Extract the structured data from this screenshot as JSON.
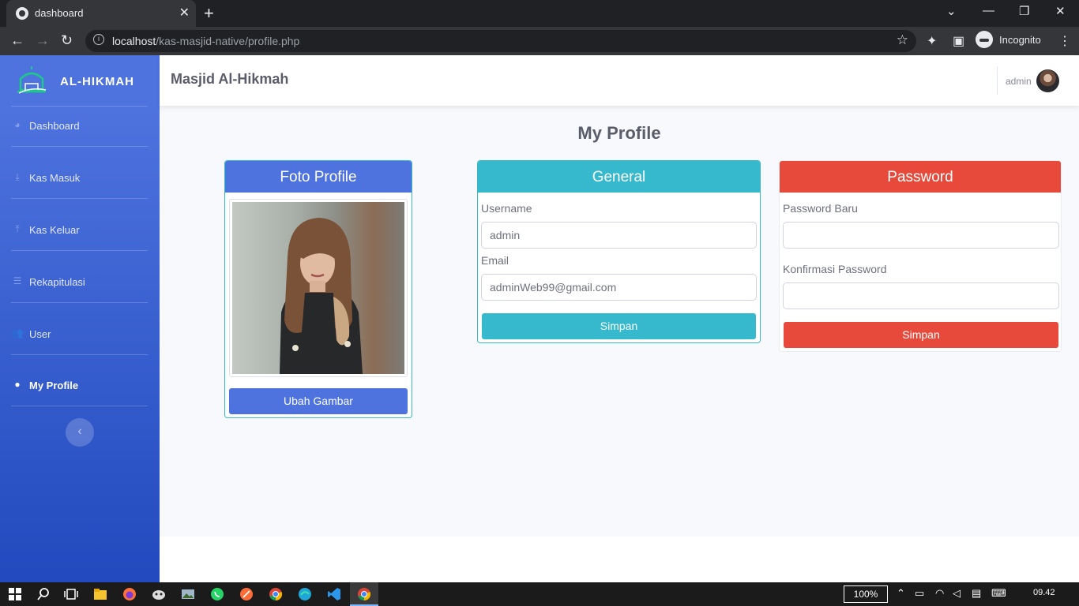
{
  "browser": {
    "tab_title": "dashboard",
    "url_host": "localhost",
    "url_path": "/kas-masjid-native/profile.php",
    "incognito_label": "Incognito",
    "zoom": "100%"
  },
  "sidebar": {
    "brand": "AL-HIKMAH",
    "items": [
      {
        "label": "Dashboard",
        "icon": "tachometer-icon"
      },
      {
        "label": "Kas Masuk",
        "icon": "download-icon"
      },
      {
        "label": "Kas Keluar",
        "icon": "upload-icon"
      },
      {
        "label": "Rekapitulasi",
        "icon": "list-icon"
      },
      {
        "label": "User",
        "icon": "users-icon"
      },
      {
        "label": "My Profile",
        "icon": "user-icon"
      }
    ],
    "active_item": "My Profile"
  },
  "topbar": {
    "site_title": "Masjid Al-Hikmah",
    "user_name": "admin"
  },
  "page": {
    "title": "My Profile"
  },
  "foto_card": {
    "header": "Foto Profile",
    "button": "Ubah Gambar"
  },
  "general_card": {
    "header": "General",
    "username_label": "Username",
    "username_value": "admin",
    "email_label": "Email",
    "email_value": "adminWeb99@gmail.com",
    "button": "Simpan"
  },
  "password_card": {
    "header": "Password",
    "new_label": "Password Baru",
    "new_value": "",
    "confirm_label": "Konfirmasi Password",
    "confirm_value": "",
    "button": "Simpan"
  },
  "taskbar": {
    "clock": "09.42"
  },
  "colors": {
    "primary": "#4e73df",
    "info": "#36b9cc",
    "danger": "#e74a3b",
    "text": "#5a5c69"
  }
}
